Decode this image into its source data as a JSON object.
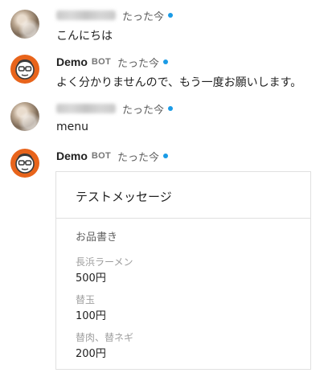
{
  "bot": {
    "name": "Demo",
    "badge": "BOT"
  },
  "messages": [
    {
      "sender": "user",
      "time": "たった今",
      "text": "こんにちは"
    },
    {
      "sender": "bot",
      "time": "たった今",
      "text": "よく分かりませんので、もう一度お願いします。"
    },
    {
      "sender": "user",
      "time": "たった今",
      "text": "menu"
    },
    {
      "sender": "bot",
      "time": "たった今"
    }
  ],
  "card": {
    "title": "テストメッセージ",
    "heading": "お品書き",
    "items": [
      {
        "name": "長浜ラーメン",
        "price": "500円"
      },
      {
        "name": "替玉",
        "price": "100円"
      },
      {
        "name": "替肉、替ネギ",
        "price": "200円"
      }
    ]
  },
  "colors": {
    "bot_avatar": "#e8641b",
    "online_dot": "#1a9be6",
    "border": "#e0e0e0"
  }
}
